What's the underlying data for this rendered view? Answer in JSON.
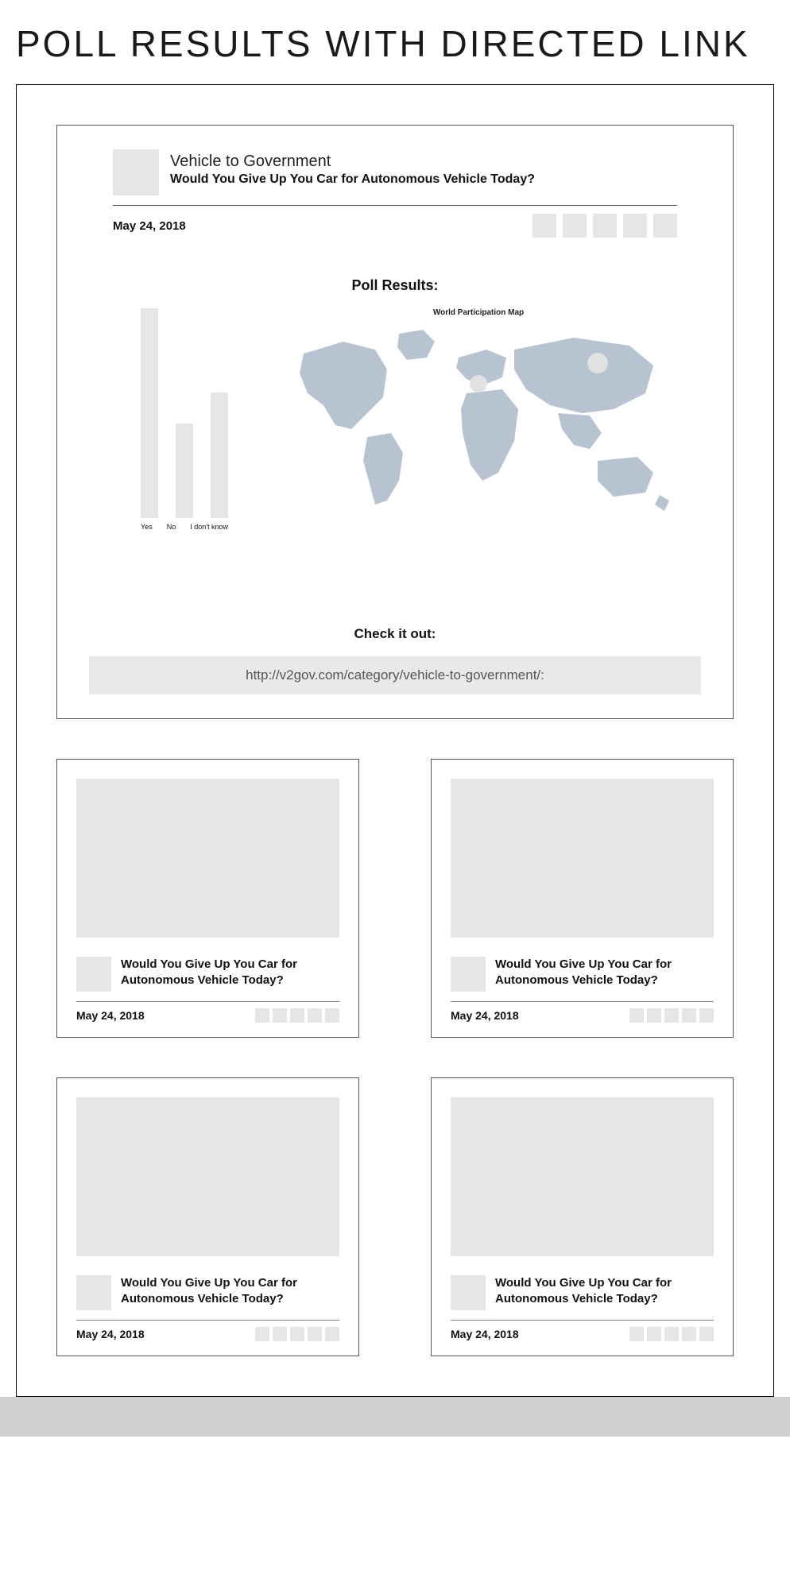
{
  "page_title": "POLL RESULTS WITH DIRECTED LINK",
  "main": {
    "category": "Vehicle to Government",
    "question": "Would You Give Up You Car for Autonomous Vehicle Today?",
    "date": "May 24, 2018",
    "poll_results_label": "Poll Results:",
    "map_caption": "World Participation Map",
    "check_it_out_label": "Check it out:",
    "link": "http://v2gov.com/category/vehicle-to-government/:"
  },
  "chart_data": {
    "type": "bar",
    "categories": [
      "Yes",
      "No",
      "I don't know"
    ],
    "values": [
      100,
      45,
      60
    ],
    "title": "Poll Results:",
    "xlabel": "",
    "ylabel": "",
    "ylim": [
      0,
      100
    ]
  },
  "cards": [
    {
      "question": "Would You Give Up You Car for Autonomous Vehicle Today?",
      "date": "May 24, 2018"
    },
    {
      "question": "Would You Give Up You Car for Autonomous Vehicle Today?",
      "date": "May 24, 2018"
    },
    {
      "question": "Would You Give Up You Car for Autonomous Vehicle Today?",
      "date": "May 24, 2018"
    },
    {
      "question": "Would You Give Up You Car for Autonomous Vehicle Today?",
      "date": "May 24, 2018"
    }
  ]
}
